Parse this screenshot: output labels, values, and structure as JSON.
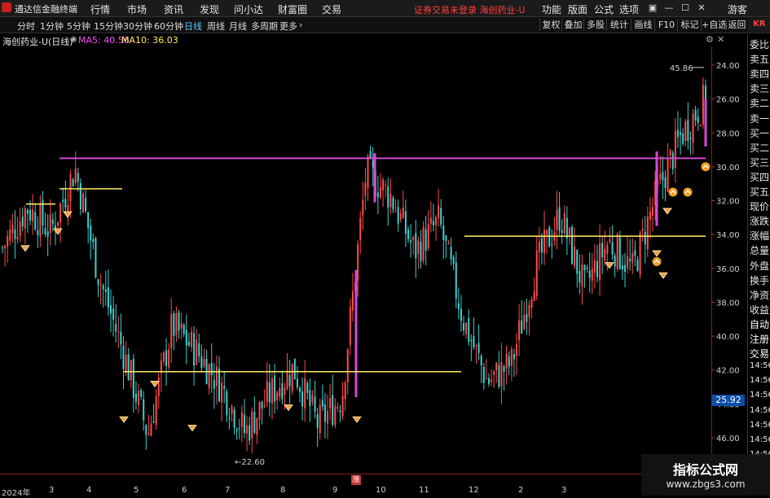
{
  "app": {
    "name": "通达信金融终端"
  },
  "menu": [
    "行情",
    "市场",
    "资讯",
    "发现",
    "问小达",
    "财富圈",
    "交易"
  ],
  "notice": "证券交易未登录  海创药业-U",
  "right_menu": [
    "功能",
    "版面",
    "公式",
    "选项"
  ],
  "user": "游客",
  "periods": [
    "分时",
    "1分钟",
    "5分钟",
    "15分钟",
    "30分钟",
    "60分钟",
    "日线",
    "周线",
    "月线",
    "多周期",
    "更多"
  ],
  "active_period": "日线",
  "tools": [
    "复权",
    "叠加",
    "多股",
    "统计",
    "画线",
    "F10",
    "标记",
    "+自选",
    "返回"
  ],
  "kr_tag": "KR",
  "stock": {
    "title": "海创药业-U(日线)",
    "ma5": "MA5: 40.56",
    "ma10": "MA10: 36.03"
  },
  "panel_items": [
    "委比",
    "卖五",
    "卖四",
    "卖三",
    "卖二",
    "卖一",
    "买一",
    "买二",
    "买三",
    "买四",
    "买五",
    "现价",
    "涨跌",
    "涨幅",
    "总量",
    "外盘",
    "换手",
    "净资",
    "收益",
    "自动",
    "注册",
    "交易",
    "14:56",
    "14:56",
    "14:56",
    "14:56",
    "14:56",
    "14:56",
    "14:56"
  ],
  "colors": {
    "up": "#ff4a4a",
    "down": "#3fd0d0",
    "ma5": "#ff4bff",
    "ma10": "#ffee60",
    "level_line": "#ffee60",
    "magenta_line": "#d24bd2",
    "accent": "#5ec4ff"
  },
  "y_ticks": [
    "46.00",
    "44.00",
    "42.00",
    "40.00",
    "38.00",
    "36.00",
    "34.00",
    "32.00",
    "30.00",
    "28.00",
    "26.00",
    "24.00"
  ],
  "x_labels": [
    "2024年",
    "3",
    "4",
    "5",
    "6",
    "7",
    "8",
    "9",
    "10",
    "11",
    "12",
    "2",
    "3"
  ],
  "annotations": {
    "high": "45.86",
    "low": "22.60",
    "current": "25.92"
  },
  "zhang": "涨",
  "watermark": {
    "title": "指标公式网",
    "url": "www.zbgs3.com"
  },
  "chart_data": {
    "type": "candlestick",
    "y_range": [
      22,
      47
    ],
    "y_ticks": [
      24,
      26,
      28,
      30,
      32,
      34,
      36,
      38,
      40,
      42,
      44,
      46
    ],
    "x_labels": [
      "2024年",
      "3",
      "4",
      "5",
      "6",
      "7",
      "8",
      "9",
      "10",
      "11",
      "12",
      "2",
      "3"
    ],
    "high_mark": 45.86,
    "low_mark": 22.6,
    "current_price": 25.92,
    "levels": [
      {
        "price": 40.5,
        "color": "magenta"
      },
      {
        "price": 38.7,
        "color": "yellow"
      },
      {
        "price": 37.8,
        "color": "yellow"
      },
      {
        "price": 27.9,
        "color": "yellow"
      },
      {
        "price": 35.9,
        "color": "yellow"
      }
    ],
    "key_closes": [
      35.2,
      37.6,
      36.2,
      39.9,
      33.4,
      29.0,
      24.2,
      30.6,
      29.1,
      27.1,
      24.3,
      26.5,
      28.1,
      24.8,
      26.4,
      39.7,
      38.3,
      35.0,
      36.8,
      31.0,
      27.3,
      28.4,
      34.1,
      37.2,
      32.8,
      35.6,
      33.9,
      38.5,
      41.9,
      44.0
    ]
  }
}
